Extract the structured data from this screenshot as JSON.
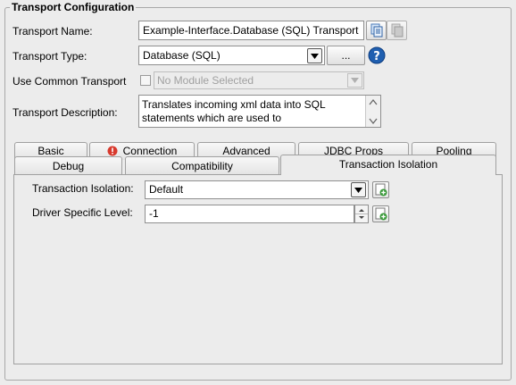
{
  "group_title": "Transport Configuration",
  "transport_name": {
    "label": "Transport Name:",
    "value": "Example-Interface.Database (SQL) Transport"
  },
  "transport_type": {
    "label": "Transport Type:",
    "value": "Database (SQL)",
    "browse_label": "..."
  },
  "common_transport": {
    "label": "Use Common Transport",
    "checked": false,
    "placeholder": "No Module Selected"
  },
  "description": {
    "label": "Transport Description:",
    "line1": "Translates incoming xml data into SQL",
    "line2": "statements which are used to"
  },
  "tabs_row1": [
    "Basic",
    "Connection",
    "Advanced",
    "JDBC Props",
    "Pooling"
  ],
  "tabs_row2": [
    "Debug",
    "Compatibility",
    "Transaction Isolation"
  ],
  "active_tab": "Transaction Isolation",
  "isolation": {
    "label": "Transaction Isolation:",
    "value": "Default"
  },
  "driver_level": {
    "label": "Driver Specific Level:",
    "value": "-1"
  },
  "colors": {
    "error_badge": "#d83a2e",
    "help_icon": "#1f5fb0"
  },
  "icons": [
    "copy-icon",
    "paste-icon",
    "help-icon",
    "error-icon",
    "add-icon",
    "dropdown-arrow-icon"
  ]
}
